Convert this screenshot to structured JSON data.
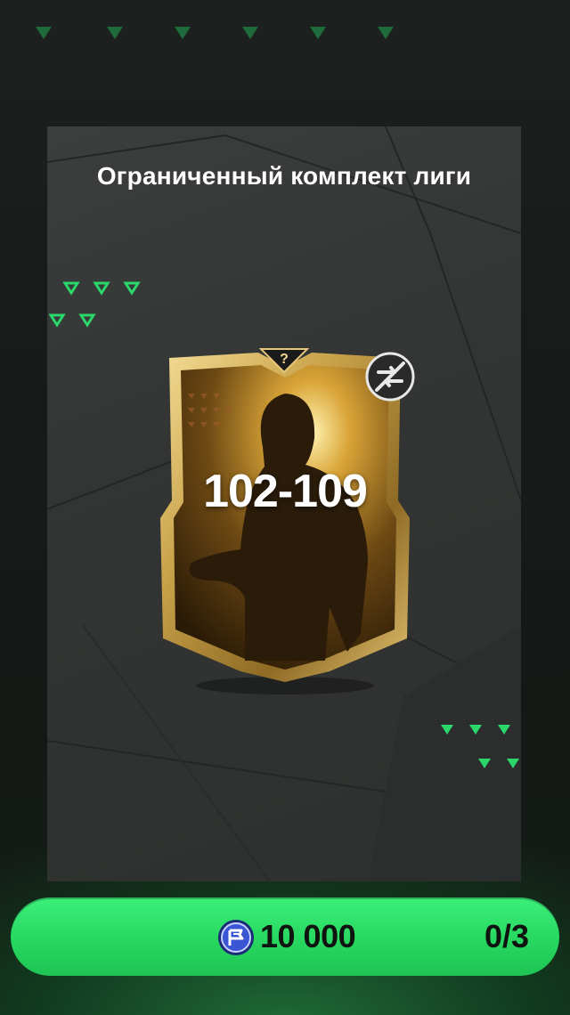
{
  "pack": {
    "title": "Ограниченный комплект лиги",
    "rating_range": "102-109",
    "card_top_icon": "question-mark-icon",
    "untradeable_icon": "untradeable-icon"
  },
  "purchase": {
    "currency_icon": "coin-icon",
    "price": "10 000",
    "limit": "0/3"
  },
  "colors": {
    "accent_green": "#2ee36a",
    "panel": "#353736",
    "card_gold": "#c9a24a",
    "arrow_green": "#2bd66a"
  }
}
